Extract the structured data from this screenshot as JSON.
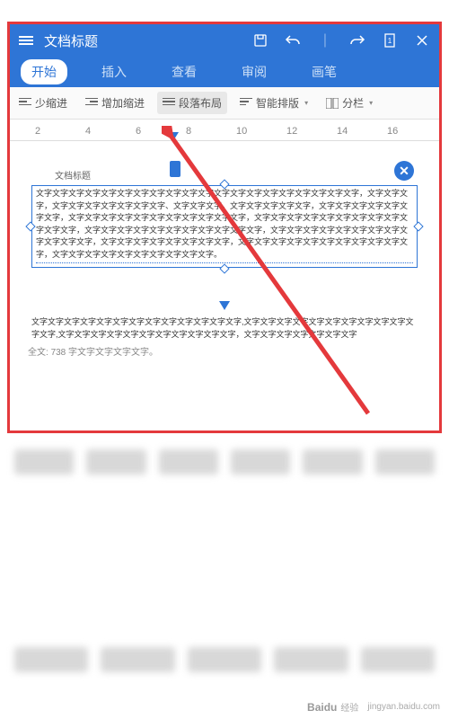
{
  "titlebar": {
    "title": "文档标题"
  },
  "tabs": [
    {
      "label": "开始",
      "active": true
    },
    {
      "label": "插入",
      "active": false
    },
    {
      "label": "查看",
      "active": false
    },
    {
      "label": "审阅",
      "active": false
    },
    {
      "label": "画笔",
      "active": false
    }
  ],
  "toolbar": {
    "decrease_indent": "少缩进",
    "increase_indent": "增加缩进",
    "paragraph_layout": "段落布局",
    "smart_layout": "智能排版",
    "columns": "分栏"
  },
  "ruler": {
    "numbers": [
      2,
      4,
      6,
      8,
      10,
      12,
      14,
      16
    ],
    "marker_at": 4
  },
  "document": {
    "heading": "文档标题",
    "para1": "文字文字文字文字文字文字文字文字文字文字文字文字文字文字文字文字文字文字文字文字，文字文字文字，文字文字文字文字文字文字文字、文字文字文字，文字文字文字文字文字，文字文字文字文字文字文字文字，文字文字文字文字文字文字文字文字文字文字文字，文字文字文字文字文字文字文字文字文字文字文字文字，文字文字文字文字文字文字文字文字文字文字文字，文字文字文字文字文字文字文字文字文字文字文字文字，文字文字文字文字文字文字文字文字，文字文字文字文字文字文字文字文字文字文字文字，文字文字文字文字文字文字文字文字文字文字。",
    "para2": "文字文字文字文字文字文字文字文字文字文字文字文字文字,文字文字文字文字文字文字文字文字文字文字文字文字,文字文字文字文字文字文字文字文字文字文字文字，文字文字文字文字文字文字文字",
    "footer_prefix": "全文: ",
    "footer_count": "738",
    "footer_suffix": "字文字文字文字文字。"
  },
  "watermark": {
    "brand": "Baidu",
    "sub": "经验",
    "url": "jingyan.baidu.com"
  }
}
